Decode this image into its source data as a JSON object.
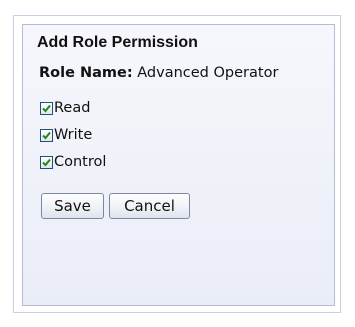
{
  "form": {
    "title": "Add Role Permission",
    "role_name_label": "Role Name:",
    "role_name_value": "Advanced Operator",
    "permissions": [
      {
        "label": "Read",
        "checked": true
      },
      {
        "label": "Write",
        "checked": true
      },
      {
        "label": "Control",
        "checked": true
      }
    ],
    "save_label": "Save",
    "cancel_label": "Cancel"
  },
  "colors": {
    "checkmark": "#1a8a1a",
    "checkbox_border": "#1c5180",
    "panel_border": "#b3bbd6"
  }
}
